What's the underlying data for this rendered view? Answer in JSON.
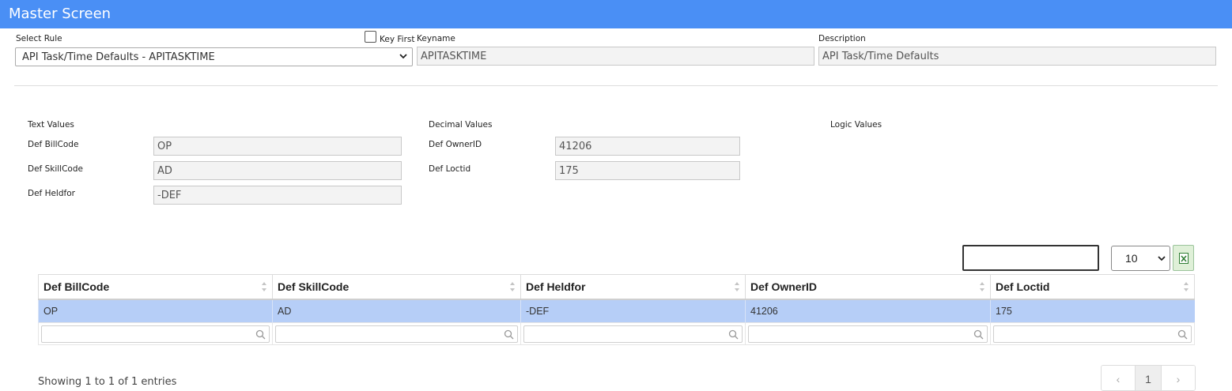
{
  "header": {
    "title": "Master Screen"
  },
  "top_form": {
    "select_rule_label": "Select Rule",
    "select_rule_value": "API Task/Time Defaults - APITASKTIME",
    "key_first_label": "Key First",
    "keyname_label": "Keyname",
    "keyname_value": "APITASKTIME",
    "description_label": "Description",
    "description_value": "API Task/Time Defaults"
  },
  "values": {
    "text_heading": "Text Values",
    "decimal_heading": "Decimal Values",
    "logic_heading": "Logic Values",
    "text_fields": [
      {
        "label": "Def BillCode",
        "value": "OP"
      },
      {
        "label": "Def SkillCode",
        "value": "AD"
      },
      {
        "label": "Def Heldfor",
        "value": "-DEF"
      }
    ],
    "decimal_fields": [
      {
        "label": "Def OwnerID",
        "value": "41206"
      },
      {
        "label": "Def Loctid",
        "value": "175"
      }
    ]
  },
  "table_controls": {
    "page_size": "10"
  },
  "table": {
    "columns": [
      "Def BillCode",
      "Def SkillCode",
      "Def Heldfor",
      "Def OwnerID",
      "Def Loctid"
    ],
    "rows": [
      [
        "OP",
        "AD",
        "-DEF",
        "41206",
        "175"
      ]
    ]
  },
  "footer": {
    "showing": "Showing 1 to 1 of 1 entries",
    "pager": {
      "prev": "‹",
      "current": "1",
      "next": "›"
    }
  },
  "colors": {
    "header_bg": "#4a8ff5",
    "selected_row": "#b6cef7"
  }
}
